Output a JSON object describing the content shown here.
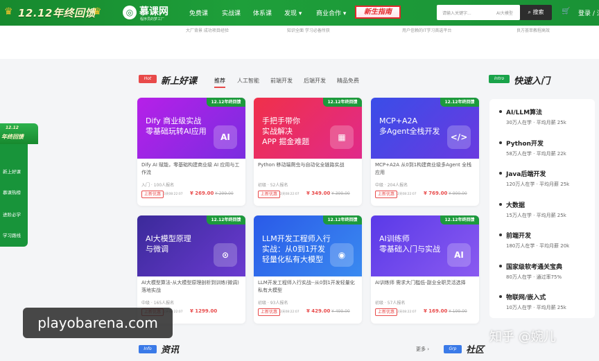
{
  "header": {
    "promo": "12.12年终回馈",
    "logo_icon": "◎",
    "logo_name": "慕课网",
    "logo_sub": "程序员的梦工厂",
    "nav": [
      "免费课",
      "实战课",
      "体系课",
      "发现 ▾",
      "商业合作 ▾"
    ],
    "guide": "新生指南",
    "search_placeholder": "请输入关键字...",
    "search_tag": "AI大模型",
    "search_button": "搜索",
    "cart_icon": "🛒",
    "login": "登录 / 注册"
  },
  "strip": [
    "大厂背景 成功项目经验",
    "知识全面 学习必备所获",
    "用户信赖的IT学习首选平台",
    "良方荟萃教程高效"
  ],
  "new_courses": {
    "badge": "Hot",
    "title": "新上好课",
    "tabs": [
      "推荐",
      "人工智能",
      "前端开发",
      "后端开发",
      "精品免费"
    ]
  },
  "courses": [
    {
      "badge": "12.12年终回馈",
      "banner_title": "Dify 商业级实战\n零基础玩转AI应用",
      "banner_icon": "AI",
      "color_a": "#b620e8",
      "color_b": "#7a2de0",
      "title": "Dify AI 赋能，零基础构建商业级 AI 应用与工作流",
      "meta": "入门 · 100人报名",
      "tag": "上新优惠",
      "time": "3天08:22:07",
      "price": "¥ 269.00",
      "old": "¥ 299.00"
    },
    {
      "badge": "12.12年终回馈",
      "banner_title": "手把手带你\n实战解决\nAPP 掘金难题",
      "banner_icon": "▦",
      "color_a": "#f0304a",
      "color_b": "#e02a8a",
      "title": "Python 移动端爬虫与自动化全链路实战",
      "meta": "初级 · 52人报名",
      "tag": "上新优惠",
      "time": "2天08:22:07",
      "price": "¥ 349.00",
      "old": "¥ 399.00"
    },
    {
      "badge": "12.12年终回馈",
      "banner_title": "MCP+A2A\n多Agent全栈开发",
      "banner_icon": "</>",
      "color_a": "#3a4de8",
      "color_b": "#6a3ae0",
      "title": "MCP+A2A 从0到1构建商业级多Agent 全栈应用",
      "meta": "中级 · 204人报名",
      "tag": "上新优惠",
      "time": "2天08:22:07",
      "price": "¥ 769.00",
      "old": "¥ 900.00"
    },
    {
      "badge": "12.12年终回馈",
      "banner_title": "AI大模型原理\n与微调",
      "banner_icon": "⊙",
      "color_a": "#3b2a9a",
      "color_b": "#6a3ad0",
      "title": "AI大模型算法-从大模型原理剖析到训练(微调)落地实战",
      "meta": "中级 · 165人报名",
      "tag": "上新优惠",
      "time": "2天08:22:07",
      "price": "¥ 1299.00",
      "old": ""
    },
    {
      "badge": "12.12年终回馈",
      "banner_title": "LLM开发工程师入行\n实战：从0到1开发\n轻量化私有大模型",
      "banner_icon": "◉",
      "color_a": "#2a5ae8",
      "color_b": "#3a8af0",
      "title": "LLM开发工程师入行实战--从0到1开发轻量化私有大模型",
      "meta": "初级 · 93人报名",
      "tag": "上新优惠",
      "time": "2天08:22:07",
      "price": "¥ 429.00",
      "old": "¥ 499.00"
    },
    {
      "badge": "12.12年终回馈",
      "banner_title": "AI训练师\n零基础入门与实战",
      "banner_icon": "AI",
      "color_a": "#5a3ae8",
      "color_b": "#8a5af0",
      "title": "AI训练师 需求大门槛低-副业全职灵活选择",
      "meta": "初级 · 57人报名",
      "tag": "上新优惠",
      "time": "2天08:22:07",
      "price": "¥ 169.00",
      "old": "¥ 199.00"
    }
  ],
  "quick_intro": {
    "badge": "Intro",
    "title": "快速入门",
    "items": [
      {
        "title": "AI/LLM算法",
        "sub": "30万人在学 · 平均月薪 25k"
      },
      {
        "title": "Python开发",
        "sub": "58万人在学 · 平均月薪 22k"
      },
      {
        "title": "Java后端开发",
        "sub": "120万人在学 · 平均月薪 25k"
      },
      {
        "title": "大数据",
        "sub": "15万人在学 · 平均月薪 25k"
      },
      {
        "title": "前端开发",
        "sub": "180万人在学 · 平均月薪 20k"
      },
      {
        "title": "国家级软考通关宝典",
        "sub": "80万人在学 · 通过率75%"
      },
      {
        "title": "物联网/嵌入式",
        "sub": "10万人在学 · 平均月薪 25k"
      }
    ]
  },
  "left_float": {
    "year": "12.12",
    "title": "年终回馈",
    "items": [
      "新上好课",
      "慕课热榜",
      "进阶必学",
      "学习路线"
    ]
  },
  "bottom": {
    "news_badge": "Info",
    "news_title": "资讯",
    "more": "更多 ›",
    "community_badge": "Grp",
    "community_title": "社区"
  },
  "watermark": "知乎 @婉儿",
  "overlay": "playobarena.com"
}
